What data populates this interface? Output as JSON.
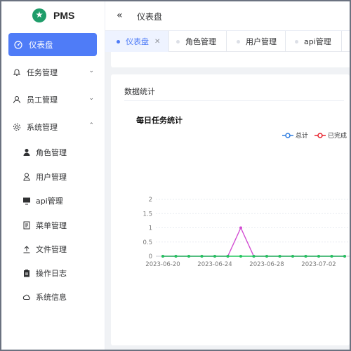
{
  "app": {
    "name": "PMS"
  },
  "sidebar": {
    "items": [
      {
        "label": "仪表盘",
        "icon": "dashboard-icon",
        "active": true
      },
      {
        "label": "任务管理",
        "icon": "bell-icon"
      },
      {
        "label": "员工管理",
        "icon": "user-icon"
      },
      {
        "label": "系统管理",
        "icon": "gear-icon",
        "expanded": true
      }
    ],
    "subitems": [
      {
        "label": "角色管理",
        "icon": "person-filled-icon"
      },
      {
        "label": "用户管理",
        "icon": "user-outline-icon"
      },
      {
        "label": "api管理",
        "icon": "monitor-icon"
      },
      {
        "label": "菜单管理",
        "icon": "document-icon"
      },
      {
        "label": "文件管理",
        "icon": "upload-icon"
      },
      {
        "label": "操作日志",
        "icon": "clipboard-icon"
      },
      {
        "label": "系统信息",
        "icon": "cloud-icon"
      }
    ]
  },
  "header": {
    "breadcrumb": "仪表盘",
    "collapse_icon": "double-chevron-left-icon"
  },
  "tabs": [
    {
      "label": "仪表盘",
      "active": true,
      "closable": true
    },
    {
      "label": "角色管理"
    },
    {
      "label": "用户管理"
    },
    {
      "label": "api管理"
    }
  ],
  "main": {
    "card_title": "数据统计",
    "chart_title": "每日任务统计"
  },
  "colors": {
    "accent": "#4f7cf7",
    "total": "#2f7de1",
    "done": "#e8242f",
    "line_magenta": "#d24cd2",
    "line_green": "#22c55e"
  },
  "chart_data": {
    "type": "line",
    "title": "每日任务统计",
    "x": [
      "2023-06-20",
      "2023-06-21",
      "2023-06-22",
      "2023-06-23",
      "2023-06-24",
      "2023-06-25",
      "2023-06-26",
      "2023-06-27",
      "2023-06-28",
      "2023-06-29",
      "2023-06-30",
      "2023-07-01",
      "2023-07-02",
      "2023-07-03",
      "2023-07-04"
    ],
    "x_tick_labels": [
      "2023-06-20",
      "2023-06-24",
      "2023-06-28",
      "2023-07-02"
    ],
    "y_ticks": [
      "0",
      "0.5",
      "1",
      "1.5",
      "2"
    ],
    "ylim": [
      0,
      2
    ],
    "legend": [
      "总计",
      "已完成"
    ],
    "series": [
      {
        "name": "总计",
        "values": [
          0,
          0,
          0,
          0,
          0,
          0,
          1,
          0,
          0,
          0,
          0,
          0,
          0,
          0,
          0
        ]
      },
      {
        "values": [
          0,
          0,
          0,
          0,
          0,
          0,
          0,
          0,
          0,
          0,
          0,
          0,
          0,
          0,
          0
        ]
      }
    ],
    "grid": true,
    "legend_position": "top-right"
  }
}
